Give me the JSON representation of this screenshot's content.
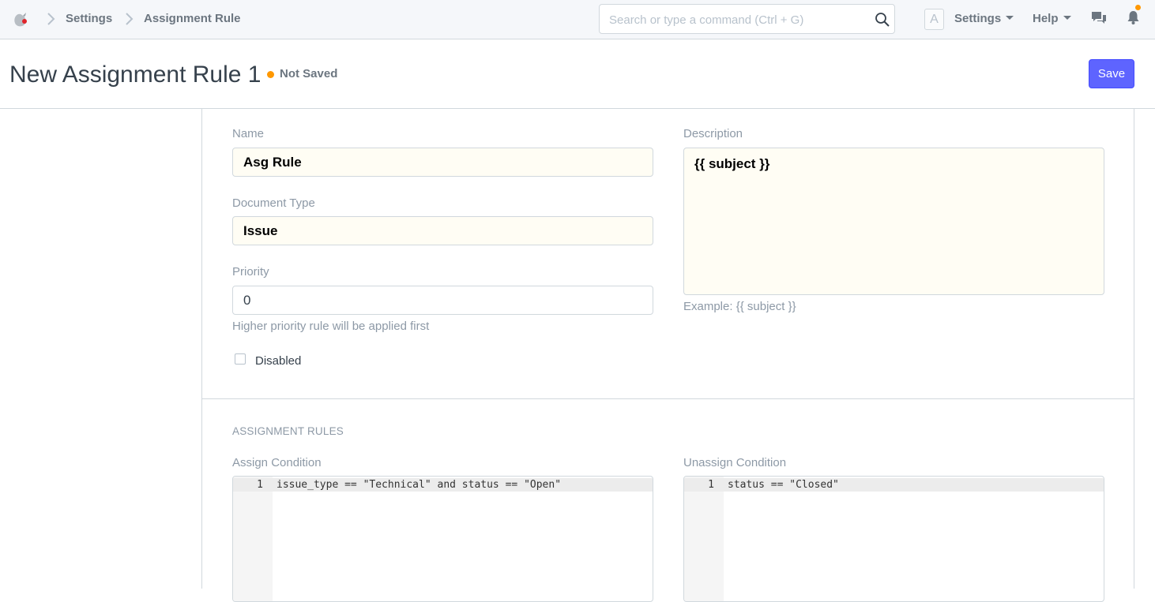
{
  "navbar": {
    "breadcrumbs": [
      "Settings",
      "Assignment Rule"
    ],
    "search_placeholder": "Search or type a command (Ctrl + G)",
    "avatar_letter": "A",
    "settings_label": "Settings",
    "help_label": "Help",
    "icons": [
      "app-logo-icon",
      "search-icon",
      "chat-icon",
      "bell-icon"
    ],
    "notification_color": "#ff9800"
  },
  "page": {
    "title": "New Assignment Rule 1",
    "status": "Not Saved",
    "status_color": "#ff9800",
    "save_label": "Save",
    "accent_color": "#5e64ff"
  },
  "form": {
    "name": {
      "label": "Name",
      "value": "Asg Rule"
    },
    "document_type": {
      "label": "Document Type",
      "value": "Issue"
    },
    "priority": {
      "label": "Priority",
      "value": "0",
      "help": "Higher priority rule will be applied first"
    },
    "disabled": {
      "label": "Disabled",
      "checked": false
    },
    "description": {
      "label": "Description",
      "value": "{{ subject }}",
      "help": "Example: {{ subject }}"
    }
  },
  "assignment_rules": {
    "heading": "ASSIGNMENT RULES",
    "assign_condition": {
      "label": "Assign Condition",
      "line_number": "1",
      "code": "issue_type == \"Technical\" and status == \"Open\""
    },
    "unassign_condition": {
      "label": "Unassign Condition",
      "line_number": "1",
      "code": "status == \"Closed\""
    }
  }
}
